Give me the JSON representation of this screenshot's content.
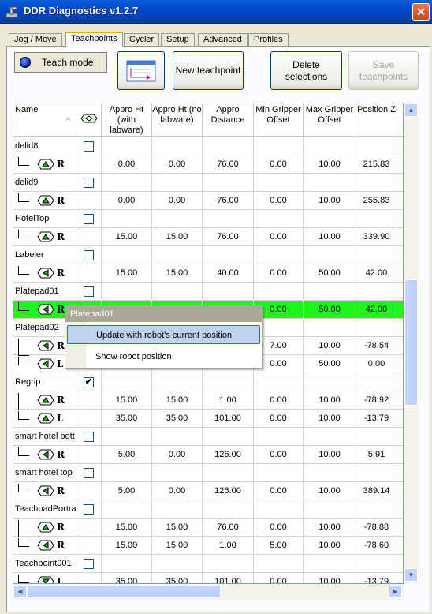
{
  "window": {
    "title": "DDR Diagnostics v1.2.7",
    "close_glyph": "✕"
  },
  "tabs": [
    {
      "label": "Jog / Move"
    },
    {
      "label": "Teachpoints",
      "active": true
    },
    {
      "label": "Cycler"
    },
    {
      "label": "Setup"
    },
    {
      "label": "Advanced"
    },
    {
      "label": "Profiles"
    }
  ],
  "toolbar": {
    "teach_mode_label": "Teach mode",
    "teachpoint_icon": "teachpoint-list-icon",
    "new_teachpoint_label": "New teachpoint",
    "delete_selections_label": "Delete selections",
    "save_teachpoints_label": "Save teachpoints"
  },
  "grid": {
    "columns": [
      {
        "label": "Name",
        "sort": "ascending"
      },
      {
        "label": "",
        "icon": "teachpoint-header-icon"
      },
      {
        "label": "Appro Ht (with labware)"
      },
      {
        "label": "Appro Ht (no labware)"
      },
      {
        "label": "Appro Distance"
      },
      {
        "label": "Min Gripper Offset"
      },
      {
        "label": "Max Gripper Offset"
      },
      {
        "label": "Position Z"
      }
    ],
    "rows": [
      {
        "type": "name",
        "name": "delid8",
        "checked": false
      },
      {
        "type": "point",
        "arm": "R",
        "icon": "arm-up",
        "vals": [
          "0.00",
          "0.00",
          "76.00",
          "0.00",
          "10.00",
          "215.83"
        ]
      },
      {
        "type": "name",
        "name": "delid9",
        "checked": false
      },
      {
        "type": "point",
        "arm": "R",
        "icon": "arm-up",
        "vals": [
          "0.00",
          "0.00",
          "76.00",
          "0.00",
          "10.00",
          "255.83"
        ]
      },
      {
        "type": "name",
        "name": "HotelTop",
        "checked": false
      },
      {
        "type": "point",
        "arm": "R",
        "icon": "arm-up",
        "vals": [
          "15.00",
          "15.00",
          "76.00",
          "0.00",
          "10.00",
          "339.90"
        ]
      },
      {
        "type": "name",
        "name": "Labeler",
        "checked": false
      },
      {
        "type": "point",
        "arm": "R",
        "icon": "arm-left",
        "vals": [
          "15.00",
          "15.00",
          "40.00",
          "0.00",
          "50.00",
          "42.00"
        ]
      },
      {
        "type": "name",
        "name": "Platepad01",
        "checked": false
      },
      {
        "type": "point",
        "arm": "R",
        "icon": "arm-left",
        "selected": true,
        "vals": [
          "",
          "",
          "",
          "0.00",
          "50.00",
          "42.00"
        ]
      },
      {
        "type": "name",
        "name": "Platepad02",
        "checked": false
      },
      {
        "type": "point",
        "arm": "R",
        "icon": "arm-left",
        "branch": true,
        "vals": [
          "",
          "",
          "",
          "7.00",
          "10.00",
          "-78.54"
        ]
      },
      {
        "type": "point",
        "arm": "L",
        "icon": "arm-left",
        "vals": [
          "",
          "",
          "",
          "0.00",
          "50.00",
          "0.00"
        ]
      },
      {
        "type": "name",
        "name": "Regrip",
        "checked": true
      },
      {
        "type": "point",
        "arm": "R",
        "icon": "arm-up",
        "branch": true,
        "vals": [
          "15.00",
          "15.00",
          "1.00",
          "0.00",
          "10.00",
          "-78.92"
        ]
      },
      {
        "type": "point",
        "arm": "L",
        "icon": "arm-up",
        "vals": [
          "35.00",
          "35.00",
          "101.00",
          "0.00",
          "10.00",
          "-13.79"
        ]
      },
      {
        "type": "name",
        "name": "smart hotel bott",
        "checked": false
      },
      {
        "type": "point",
        "arm": "R",
        "icon": "arm-left",
        "vals": [
          "5.00",
          "0.00",
          "126.00",
          "0.00",
          "10.00",
          "5.91"
        ]
      },
      {
        "type": "name",
        "name": "smart hotel top",
        "checked": false
      },
      {
        "type": "point",
        "arm": "R",
        "icon": "arm-left",
        "vals": [
          "5.00",
          "0.00",
          "126.00",
          "0.00",
          "10.00",
          "389.14"
        ]
      },
      {
        "type": "name",
        "name": "TeachpadPortra",
        "checked": false
      },
      {
        "type": "point",
        "arm": "R",
        "icon": "arm-up",
        "branch": true,
        "vals": [
          "15.00",
          "15.00",
          "76.00",
          "0.00",
          "10.00",
          "-78.88"
        ]
      },
      {
        "type": "point",
        "arm": "R",
        "icon": "arm-left",
        "vals": [
          "15.00",
          "15.00",
          "1.00",
          "5.00",
          "10.00",
          "-78.60"
        ]
      },
      {
        "type": "name",
        "name": "Teachpoint001",
        "checked": false
      },
      {
        "type": "point",
        "arm": "L",
        "icon": "arm-down",
        "vals": [
          "35.00",
          "35.00",
          "101.00",
          "0.00",
          "10.00",
          "-13.79"
        ]
      }
    ]
  },
  "context_menu": {
    "title": "Platepad01",
    "items": [
      {
        "label": "Update with robot's current position",
        "highlighted": true
      },
      {
        "label": "Show robot position"
      }
    ]
  },
  "scrollbars": {
    "up": "▲",
    "down": "▼",
    "left": "◀",
    "right": "▶"
  },
  "colors": {
    "selected_row": "#1ef51e",
    "title_bar": "#0047c8",
    "teachpoint_icon": "#22a022"
  }
}
